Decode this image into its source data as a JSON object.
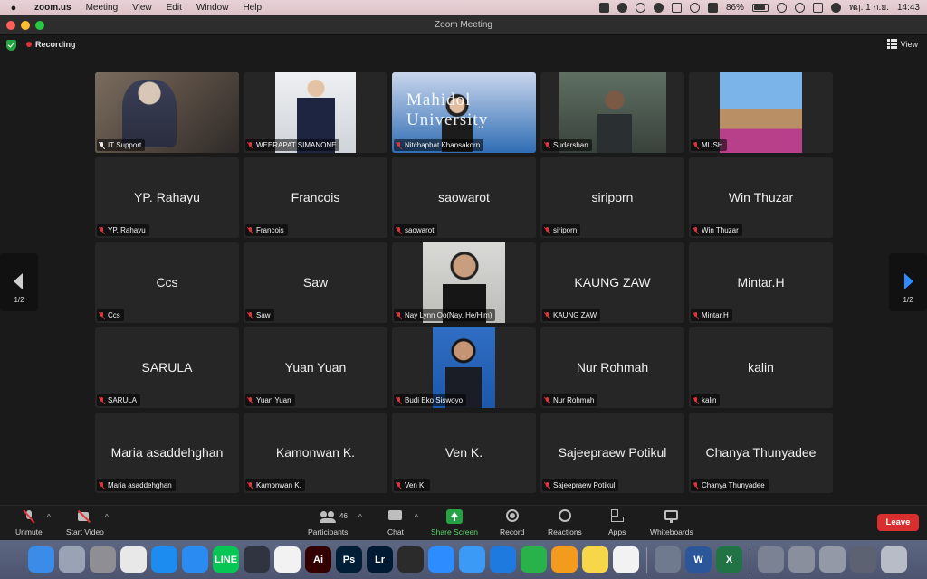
{
  "menubar": {
    "app_name": "zoom.us",
    "menus": [
      "Meeting",
      "View",
      "Edit",
      "Window",
      "Help"
    ],
    "battery": "86%",
    "battery_level": 0.86,
    "date": "พฤ. 1 ก.ย.",
    "time": "14:43"
  },
  "window": {
    "title": "Zoom Meeting"
  },
  "status": {
    "recording_label": "Recording",
    "view_label": "View"
  },
  "gallery": {
    "participants": [
      {
        "name": "IT Support",
        "video": "it",
        "active": true,
        "muted": false
      },
      {
        "name": "WEERAPAT SIMANONE",
        "video": "weer",
        "muted": true
      },
      {
        "name": "Nitchaphat Khansakorn",
        "video": "mahidol",
        "video_text": "Mahidol University",
        "muted": true
      },
      {
        "name": "Sudarshan",
        "video": "sud",
        "muted": true
      },
      {
        "name": "MUSH",
        "video": "mush",
        "muted": true
      },
      {
        "name": "YP. Rahayu",
        "muted": true
      },
      {
        "name": "Francois",
        "muted": true
      },
      {
        "name": "saowarot",
        "muted": true
      },
      {
        "name": "siriporn",
        "muted": true
      },
      {
        "name": "Win Thuzar",
        "muted": true
      },
      {
        "name": "Ccs",
        "muted": true
      },
      {
        "name": "Saw",
        "muted": true
      },
      {
        "name": "Nay Lynn Oo(Nay, He/Him)",
        "video": "nay",
        "muted": true
      },
      {
        "name": "KAUNG ZAW",
        "muted": true
      },
      {
        "name": "Mintar.H",
        "muted": true
      },
      {
        "name": "SARULA",
        "muted": true
      },
      {
        "name": "Yuan Yuan",
        "muted": true
      },
      {
        "name": "Budi Eko Siswoyo",
        "video": "budi",
        "muted": true
      },
      {
        "name": "Nur Rohmah",
        "muted": true
      },
      {
        "name": "kalin",
        "muted": true
      },
      {
        "name": "Maria asaddehghan",
        "muted": true
      },
      {
        "name": "Kamonwan K.",
        "muted": true
      },
      {
        "name": "Ven K.",
        "muted": true
      },
      {
        "name": "Sajeepraew Potikul",
        "muted": true
      },
      {
        "name": "Chanya Thunyadee",
        "muted": true
      }
    ]
  },
  "pager": {
    "left_page": "1/2",
    "right_page": "1/2"
  },
  "toolbar": {
    "unmute": "Unmute",
    "start_video": "Start Video",
    "participants": "Participants",
    "participants_count": "46",
    "chat": "Chat",
    "share_screen": "Share Screen",
    "record": "Record",
    "reactions": "Reactions",
    "apps": "Apps",
    "whiteboards": "Whiteboards",
    "leave": "Leave"
  },
  "colors": {
    "active_speaker": "#5acb4a",
    "share_green": "#25a244",
    "leave_red": "#d9302f",
    "mute_red": "#e0343c"
  },
  "dock": {
    "apps": [
      {
        "icon": "finder-icon",
        "bg": "#3b8be8",
        "glyph": ""
      },
      {
        "icon": "launchpad-icon",
        "bg": "#9aa3b5",
        "glyph": ""
      },
      {
        "icon": "system-settings-icon",
        "bg": "#8e8e93",
        "glyph": ""
      },
      {
        "icon": "preview-icon",
        "bg": "#e8e8e8",
        "glyph": ""
      },
      {
        "icon": "app-store-icon",
        "bg": "#1c8cf0",
        "glyph": ""
      },
      {
        "icon": "safari-icon",
        "bg": "#2a8cf2",
        "glyph": ""
      },
      {
        "icon": "line-icon",
        "bg": "#06c755",
        "glyph": "LINE"
      },
      {
        "icon": "davinci-icon",
        "bg": "#303440",
        "glyph": ""
      },
      {
        "icon": "photos-icon",
        "bg": "#f2f2f2",
        "glyph": ""
      },
      {
        "icon": "illustrator-icon",
        "bg": "#330000",
        "glyph": "Ai"
      },
      {
        "icon": "photoshop-icon",
        "bg": "#001e36",
        "glyph": "Ps"
      },
      {
        "icon": "lightroom-icon",
        "bg": "#001a33",
        "glyph": "Lr"
      },
      {
        "icon": "webex-icon",
        "bg": "#2b2b2b",
        "glyph": ""
      },
      {
        "icon": "zoom-icon",
        "bg": "#2d8cff",
        "glyph": ""
      },
      {
        "icon": "mail-icon",
        "bg": "#3a9af5",
        "glyph": ""
      },
      {
        "icon": "keynote-icon",
        "bg": "#1f7ae0",
        "glyph": ""
      },
      {
        "icon": "numbers-icon",
        "bg": "#29b14a",
        "glyph": ""
      },
      {
        "icon": "pages-icon",
        "bg": "#f29b1d",
        "glyph": ""
      },
      {
        "icon": "notes-icon",
        "bg": "#f7d64a",
        "glyph": ""
      },
      {
        "icon": "reminders-icon",
        "bg": "#f2f2f2",
        "glyph": ""
      },
      {
        "sep": true
      },
      {
        "icon": "screenshot-thumb-icon",
        "bg": "#6f7a8e",
        "glyph": ""
      },
      {
        "icon": "word-icon",
        "bg": "#2b579a",
        "glyph": "W"
      },
      {
        "icon": "excel-icon",
        "bg": "#217346",
        "glyph": "X"
      },
      {
        "sep": true
      },
      {
        "icon": "recent-file-1-icon",
        "bg": "#7b8294",
        "glyph": ""
      },
      {
        "icon": "recent-file-2-icon",
        "bg": "#8a8f9d",
        "glyph": ""
      },
      {
        "icon": "recent-file-3-icon",
        "bg": "#9399a6",
        "glyph": ""
      },
      {
        "icon": "recent-file-4-icon",
        "bg": "#5c6272",
        "glyph": ""
      },
      {
        "icon": "trash-icon",
        "bg": "#b8bcc6",
        "glyph": ""
      }
    ]
  }
}
